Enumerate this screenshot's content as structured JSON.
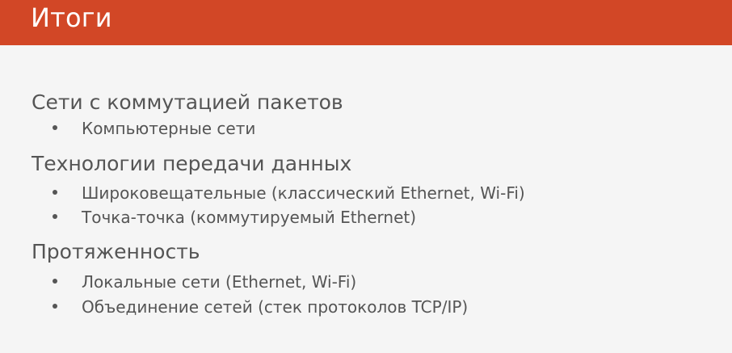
{
  "slide": {
    "title": "Итоги"
  },
  "sections": [
    {
      "heading": "Сети с коммутацией пакетов",
      "bullets": [
        "Компьютерные сети"
      ]
    },
    {
      "heading": "Технологии передачи данных",
      "bullets": [
        "Широковещательные (классический Ethernet, Wi-Fi)",
        "Точка-точка (коммутируемый Ethernet)"
      ]
    },
    {
      "heading": "Протяженность",
      "bullets": [
        "Локальные сети (Ethernet, Wi-Fi)",
        "Объединение сетей (стек протоколов TCP/IP)"
      ]
    }
  ],
  "colors": {
    "header_bg": "#d24726",
    "text": "#555555",
    "background": "#f5f5f5"
  }
}
